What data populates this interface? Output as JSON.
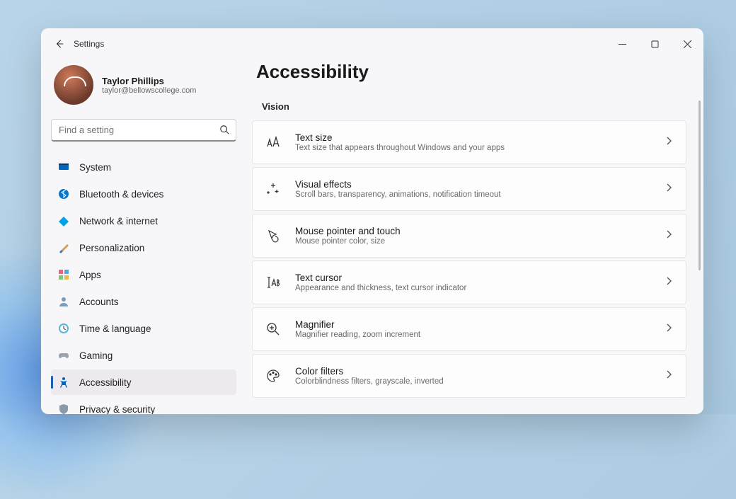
{
  "app_title": "Settings",
  "profile": {
    "name": "Taylor Phillips",
    "email": "taylor@bellowscollege.com"
  },
  "search": {
    "placeholder": "Find a setting"
  },
  "sidebar": {
    "items": [
      {
        "label": "System"
      },
      {
        "label": "Bluetooth & devices"
      },
      {
        "label": "Network & internet"
      },
      {
        "label": "Personalization"
      },
      {
        "label": "Apps"
      },
      {
        "label": "Accounts"
      },
      {
        "label": "Time & language"
      },
      {
        "label": "Gaming"
      },
      {
        "label": "Accessibility"
      },
      {
        "label": "Privacy & security"
      }
    ]
  },
  "page": {
    "title": "Accessibility",
    "section": "Vision",
    "cards": [
      {
        "title": "Text size",
        "sub": "Text size that appears throughout Windows and your apps"
      },
      {
        "title": "Visual effects",
        "sub": "Scroll bars, transparency, animations, notification timeout"
      },
      {
        "title": "Mouse pointer and touch",
        "sub": "Mouse pointer color, size"
      },
      {
        "title": "Text cursor",
        "sub": "Appearance and thickness, text cursor indicator"
      },
      {
        "title": "Magnifier",
        "sub": "Magnifier reading, zoom increment"
      },
      {
        "title": "Color filters",
        "sub": "Colorblindness filters, grayscale, inverted"
      }
    ]
  }
}
